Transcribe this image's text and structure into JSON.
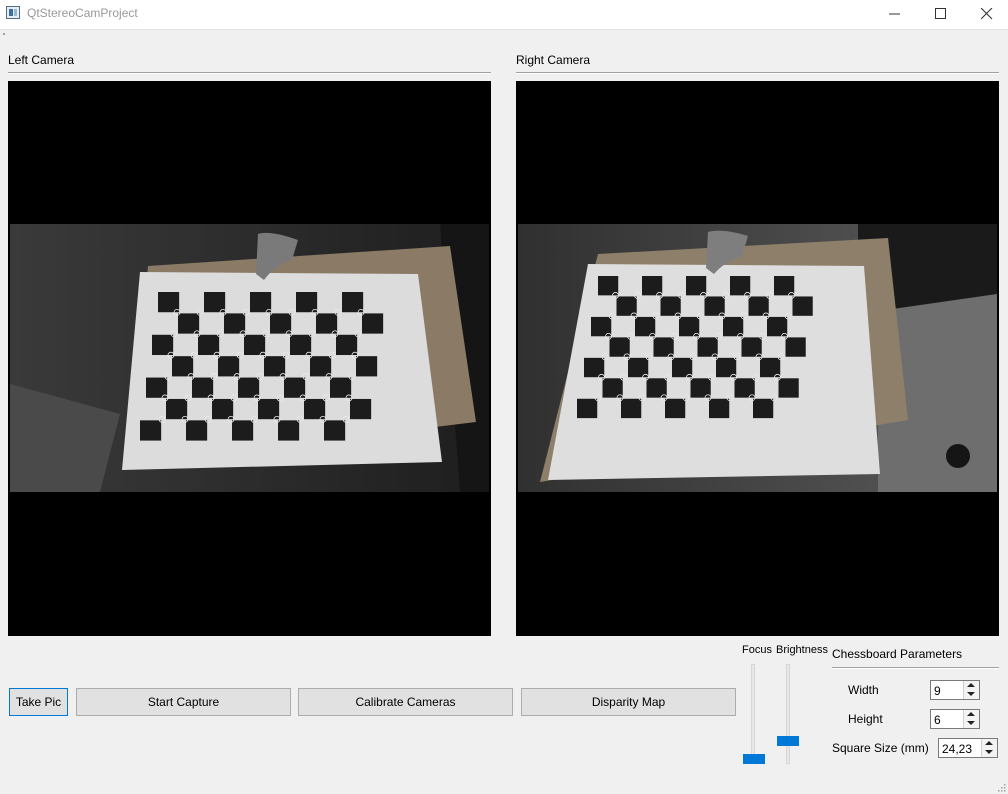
{
  "window": {
    "title": "QtStereoCamProject"
  },
  "left_camera": {
    "label": "Left Camera"
  },
  "right_camera": {
    "label": "Right Camera"
  },
  "buttons": {
    "take_pic": "Take Pic",
    "start_capture": "Start Capture",
    "calibrate": "Calibrate Cameras",
    "disparity": "Disparity Map"
  },
  "sliders": {
    "focus": {
      "label": "Focus",
      "value_fraction": 0.0
    },
    "brightness": {
      "label": "Brightness",
      "value_fraction": 0.2
    }
  },
  "chessboard": {
    "title": "Chessboard Parameters",
    "width_label": "Width",
    "width_value": "9",
    "height_label": "Height",
    "height_value": "6",
    "square_label": "Square Size (mm)",
    "square_value": "24,23"
  },
  "colors": {
    "accent": "#0078d7",
    "button_face": "#e1e1e1",
    "window_bg": "#f0f0f0"
  },
  "icons": [
    "app-icon",
    "minimize-icon",
    "maximize-icon",
    "close-icon",
    "spin-up-icon",
    "spin-down-icon",
    "size-grip-icon"
  ]
}
